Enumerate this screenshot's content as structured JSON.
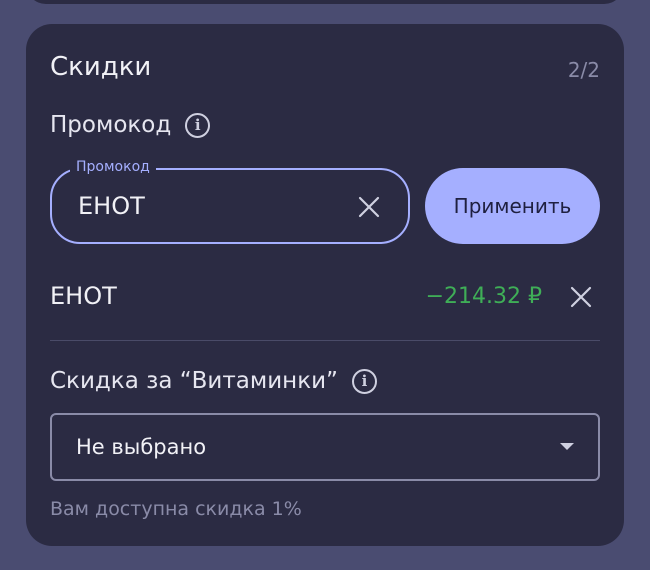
{
  "discounts": {
    "title": "Скидки",
    "counter": "2/2",
    "promo_section_label": "Промокод",
    "promo_field": {
      "legend": "Промокод",
      "value": "ЕНОТ"
    },
    "apply_button_label": "Применить",
    "applied_promo": {
      "name": "ЕНОТ",
      "amount": "−214.32 ₽"
    },
    "vitamin_section_label": "Скидка за “Витаминки”",
    "vitamin_select": {
      "selected": "Не выбрано"
    },
    "hint": "Вам доступна скидка 1%"
  },
  "colors": {
    "background": "#4a4c71",
    "card": "#2b2b43",
    "accent": "#a5afff",
    "discount_green": "#3fae57"
  },
  "icons": [
    "info-icon",
    "close-icon",
    "caret-down-icon"
  ]
}
